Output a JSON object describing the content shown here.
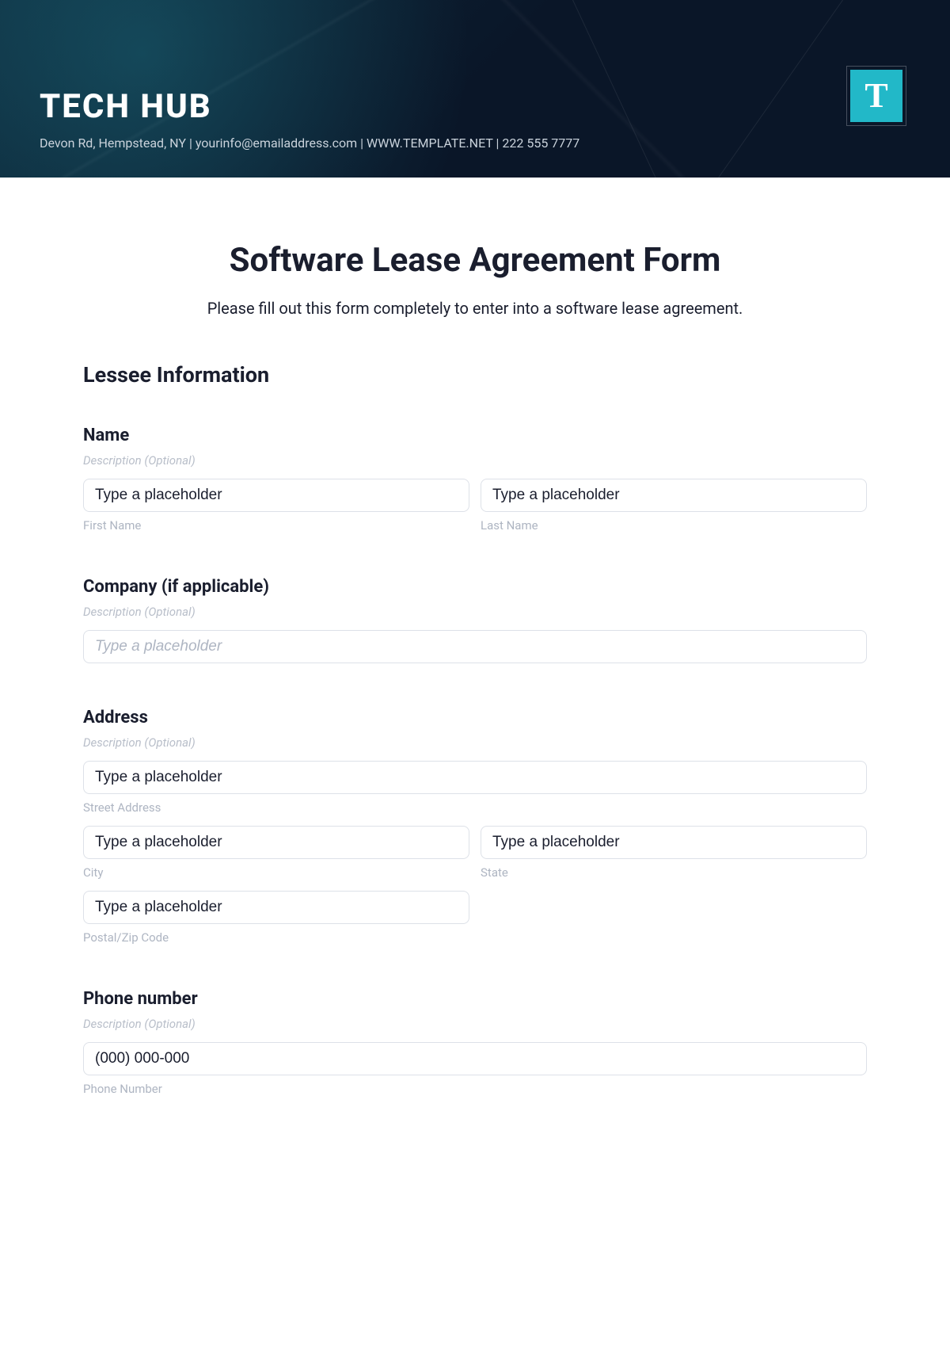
{
  "header": {
    "brand": "TECH HUB",
    "contact_line": "Devon Rd, Hempstead, NY | yourinfo@emailaddress.com | WWW.TEMPLATE.NET | 222 555 7777",
    "logo_letter": "T"
  },
  "page": {
    "title": "Software Lease Agreement Form",
    "subtitle": "Please fill out this form completely to enter into a software lease agreement."
  },
  "section": {
    "lessee_heading": "Lessee Information"
  },
  "fields": {
    "name": {
      "label": "Name",
      "desc": "Description (Optional)",
      "first_placeholder": "Type a placeholder",
      "first_sublabel": "First Name",
      "last_placeholder": "Type a placeholder",
      "last_sublabel": "Last Name"
    },
    "company": {
      "label": "Company (if applicable)",
      "desc": "Description (Optional)",
      "placeholder": "Type a placeholder"
    },
    "address": {
      "label": "Address",
      "desc": "Description (Optional)",
      "street_placeholder": "Type a placeholder",
      "street_sublabel": "Street Address",
      "city_placeholder": "Type a placeholder",
      "city_sublabel": "City",
      "state_placeholder": "Type a placeholder",
      "state_sublabel": "State",
      "postal_placeholder": "Type a placeholder",
      "postal_sublabel": "Postal/Zip Code"
    },
    "phone": {
      "label": "Phone number",
      "desc": "Description (Optional)",
      "placeholder": "(000) 000-000",
      "sublabel": "Phone Number"
    }
  }
}
